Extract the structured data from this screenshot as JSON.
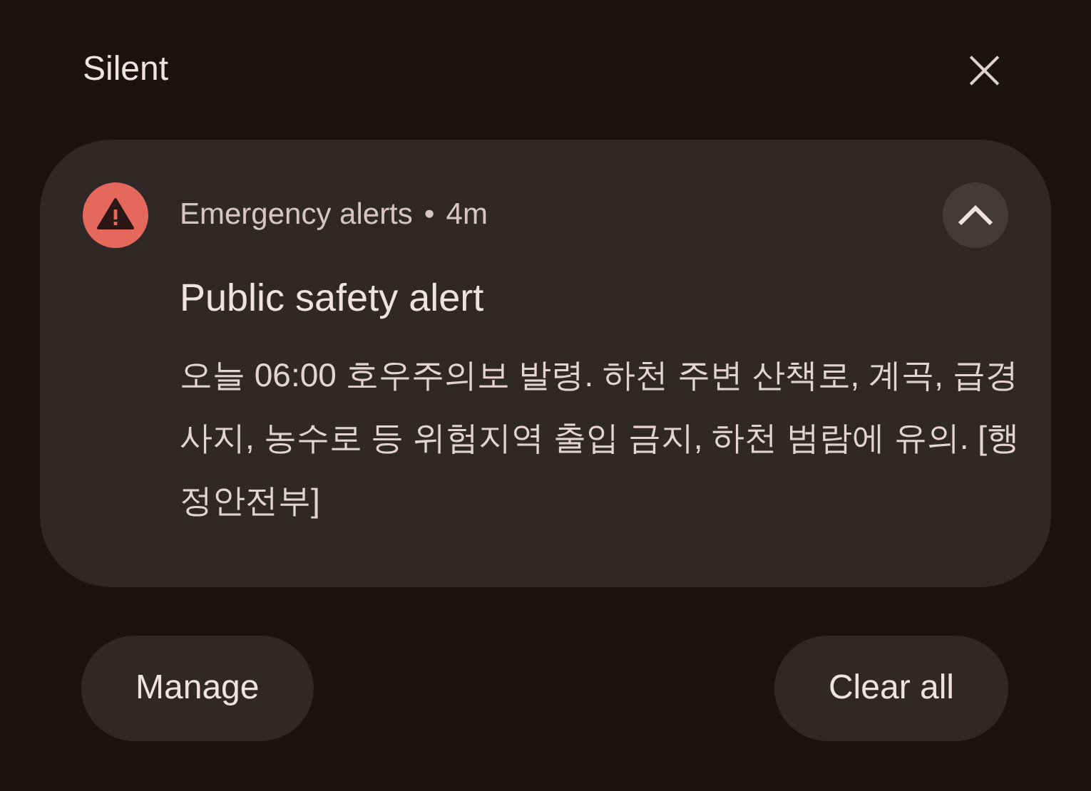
{
  "header": {
    "title": "Silent",
    "close": "×"
  },
  "notification": {
    "app": "Emergency alerts",
    "separator": "•",
    "time": "4m",
    "expanded": true,
    "title": "Public safety alert",
    "body": "오늘 06:00 호우주의보 발령. 하천 주변 산책로, 계곡, 급경사지, 농수로 등 위험지역 출입 금지, 하천 범람에 유의. [행정안전부]"
  },
  "buttons": [
    "Manage",
    "Clear all"
  ]
}
